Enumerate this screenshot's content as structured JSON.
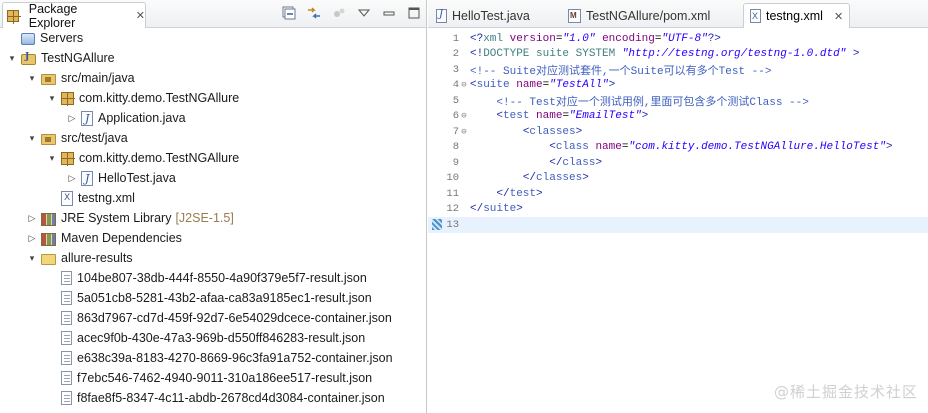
{
  "left_view": {
    "tab_title": "Package Explorer",
    "close_glyph": "✕",
    "toolbar": {
      "collapse_icon": "collapse-all-icon",
      "link_icon": "link-with-editor-icon",
      "focus_icon": "focus-on-task-icon",
      "menu_icon": "view-menu-icon",
      "minimize_icon": "minimize-icon",
      "maximize_icon": "maximize-icon"
    }
  },
  "tree": {
    "items": [
      {
        "label": "Servers",
        "decoration": "",
        "level": 0,
        "twisty": "",
        "icon": "server-icon"
      },
      {
        "label": "TestNGAllure",
        "decoration": "",
        "level": 0,
        "twisty": "▾",
        "icon": "project-icon"
      },
      {
        "label": "src/main/java",
        "decoration": "",
        "level": 1,
        "twisty": "▾",
        "icon": "source-folder-icon"
      },
      {
        "label": "com.kitty.demo.TestNGAllure",
        "decoration": "",
        "level": 2,
        "twisty": "▾",
        "icon": "package-icon"
      },
      {
        "label": "Application.java",
        "decoration": "",
        "level": 3,
        "twisty": "▷",
        "icon": "java-file-icon"
      },
      {
        "label": "src/test/java",
        "decoration": "",
        "level": 1,
        "twisty": "▾",
        "icon": "source-folder-icon"
      },
      {
        "label": "com.kitty.demo.TestNGAllure",
        "decoration": "",
        "level": 2,
        "twisty": "▾",
        "icon": "package-icon"
      },
      {
        "label": "HelloTest.java",
        "decoration": "",
        "level": 3,
        "twisty": "▷",
        "icon": "java-file-icon"
      },
      {
        "label": "testng.xml",
        "decoration": "",
        "level": 2,
        "twisty": "",
        "icon": "xml-file-icon"
      },
      {
        "label": "JRE System Library",
        "decoration": "[J2SE-1.5]",
        "level": 1,
        "twisty": "▷",
        "icon": "library-icon"
      },
      {
        "label": "Maven Dependencies",
        "decoration": "",
        "level": 1,
        "twisty": "▷",
        "icon": "library-icon"
      },
      {
        "label": "allure-results",
        "decoration": "",
        "level": 1,
        "twisty": "▾",
        "icon": "folder-icon"
      },
      {
        "label": "104be807-38db-444f-8550-4a90f379e5f7-result.json",
        "decoration": "",
        "level": 2,
        "twisty": "",
        "icon": "file-icon"
      },
      {
        "label": "5a051cb8-5281-43b2-afaa-ca83a9185ec1-result.json",
        "decoration": "",
        "level": 2,
        "twisty": "",
        "icon": "file-icon"
      },
      {
        "label": "863d7967-cd7d-459f-92d7-6e54029dcece-container.json",
        "decoration": "",
        "level": 2,
        "twisty": "",
        "icon": "file-icon"
      },
      {
        "label": "acec9f0b-430e-47a3-969b-d550ff846283-result.json",
        "decoration": "",
        "level": 2,
        "twisty": "",
        "icon": "file-icon"
      },
      {
        "label": "e638c39a-8183-4270-8669-96c3fa91a752-container.json",
        "decoration": "",
        "level": 2,
        "twisty": "",
        "icon": "file-icon"
      },
      {
        "label": "f7ebc546-7462-4940-9011-310a186ee517-result.json",
        "decoration": "",
        "level": 2,
        "twisty": "",
        "icon": "file-icon"
      },
      {
        "label": "f8fae8f5-8347-4c11-abdb-2678cd4d3084-container.json",
        "decoration": "",
        "level": 2,
        "twisty": "",
        "icon": "file-icon"
      }
    ]
  },
  "editor_tabs": [
    {
      "label": "HelloTest.java",
      "icon": "java-file-icon",
      "active": false
    },
    {
      "label": "TestNGAllure/pom.xml",
      "icon": "maven-file-icon",
      "active": false
    },
    {
      "label": "testng.xml",
      "icon": "xml-file-icon",
      "active": true,
      "close_glyph": "✕"
    }
  ],
  "editor": {
    "lines": [
      {
        "num": "1",
        "fold": "",
        "tokens": [
          [
            "tk-bracket",
            "<?"
          ],
          [
            "tk-decl",
            "xml "
          ],
          [
            "tk-attr",
            "version"
          ],
          [
            "tk-text",
            "="
          ],
          [
            "tk-val",
            "\"1.0\""
          ],
          [
            "tk-text",
            " "
          ],
          [
            "tk-attr",
            "encoding"
          ],
          [
            "tk-text",
            "="
          ],
          [
            "tk-val",
            "\"UTF-8\""
          ],
          [
            "tk-bracket",
            "?>"
          ]
        ]
      },
      {
        "num": "2",
        "fold": "",
        "tokens": [
          [
            "tk-bracket",
            "<!"
          ],
          [
            "tk-doctype",
            "DOCTYPE suite SYSTEM "
          ],
          [
            "tk-val",
            "\"http://testng.org/testng-1.0.dtd\""
          ],
          [
            "tk-text",
            " "
          ],
          [
            "tk-bracket",
            ">"
          ]
        ]
      },
      {
        "num": "3",
        "fold": "",
        "tokens": [
          [
            "tk-comment",
            "<!-- Suite对应测试套件,一个Suite可以有多个Test -->"
          ]
        ]
      },
      {
        "num": "4",
        "fold": "⊖",
        "tokens": [
          [
            "tk-bracket",
            "<"
          ],
          [
            "tk-tag",
            "suite "
          ],
          [
            "tk-attr",
            "name"
          ],
          [
            "tk-text",
            "="
          ],
          [
            "tk-val",
            "\"TestAll\""
          ],
          [
            "tk-bracket",
            ">"
          ]
        ]
      },
      {
        "num": "5",
        "fold": "",
        "tokens": [
          [
            "tk-text",
            "    "
          ],
          [
            "tk-comment",
            "<!-- Test对应一个测试用例,里面可包含多个测试Class -->"
          ]
        ]
      },
      {
        "num": "6",
        "fold": "⊖",
        "tokens": [
          [
            "tk-text",
            "    "
          ],
          [
            "tk-bracket",
            "<"
          ],
          [
            "tk-tag",
            "test "
          ],
          [
            "tk-attr",
            "name"
          ],
          [
            "tk-text",
            "="
          ],
          [
            "tk-val",
            "\"EmailTest\""
          ],
          [
            "tk-bracket",
            ">"
          ]
        ]
      },
      {
        "num": "7",
        "fold": "⊖",
        "tokens": [
          [
            "tk-text",
            "        "
          ],
          [
            "tk-bracket",
            "<"
          ],
          [
            "tk-tag",
            "classes"
          ],
          [
            "tk-bracket",
            ">"
          ]
        ]
      },
      {
        "num": "8",
        "fold": "",
        "tokens": [
          [
            "tk-text",
            "            "
          ],
          [
            "tk-bracket",
            "<"
          ],
          [
            "tk-tag",
            "class "
          ],
          [
            "tk-attr",
            "name"
          ],
          [
            "tk-text",
            "="
          ],
          [
            "tk-val",
            "\"com.kitty.demo.TestNGAllure.HelloTest\""
          ],
          [
            "tk-bracket",
            ">"
          ]
        ]
      },
      {
        "num": "9",
        "fold": "",
        "tokens": [
          [
            "tk-text",
            "            "
          ],
          [
            "tk-bracket",
            "</"
          ],
          [
            "tk-tag",
            "class"
          ],
          [
            "tk-bracket",
            ">"
          ]
        ]
      },
      {
        "num": "10",
        "fold": "",
        "tokens": [
          [
            "tk-text",
            "        "
          ],
          [
            "tk-bracket",
            "</"
          ],
          [
            "tk-tag",
            "classes"
          ],
          [
            "tk-bracket",
            ">"
          ]
        ]
      },
      {
        "num": "11",
        "fold": "",
        "tokens": [
          [
            "tk-text",
            "    "
          ],
          [
            "tk-bracket",
            "</"
          ],
          [
            "tk-tag",
            "test"
          ],
          [
            "tk-bracket",
            ">"
          ]
        ]
      },
      {
        "num": "12",
        "fold": "",
        "tokens": [
          [
            "tk-bracket",
            "</"
          ],
          [
            "tk-tag",
            "suite"
          ],
          [
            "tk-bracket",
            ">"
          ]
        ]
      },
      {
        "num": "13",
        "fold": "",
        "tokens": [],
        "current": true
      }
    ]
  },
  "watermark": "@稀土掘金技术社区"
}
